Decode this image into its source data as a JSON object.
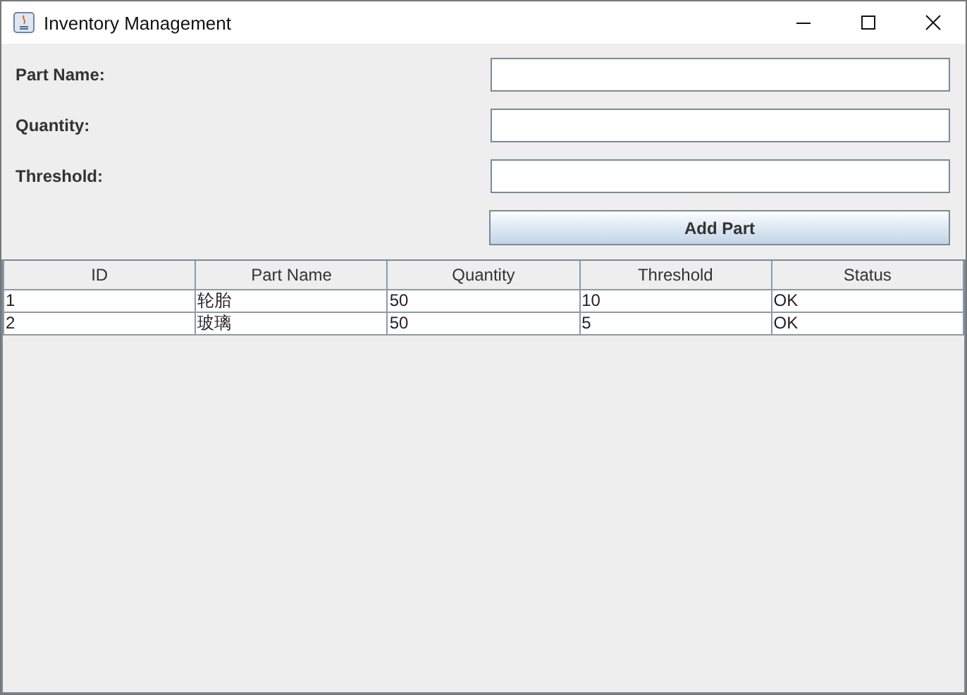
{
  "window": {
    "title": "Inventory Management"
  },
  "form": {
    "fields": [
      {
        "label": "Part Name:"
      },
      {
        "label": "Quantity:"
      },
      {
        "label": "Threshold:"
      }
    ],
    "button": "Add Part"
  },
  "table": {
    "columns": [
      "ID",
      "Part Name",
      "Quantity",
      "Threshold",
      "Status"
    ],
    "rows": [
      [
        "1",
        "轮胎",
        "50",
        "10",
        "OK"
      ],
      [
        "2",
        "玻璃",
        "50",
        "5",
        "OK"
      ]
    ]
  }
}
